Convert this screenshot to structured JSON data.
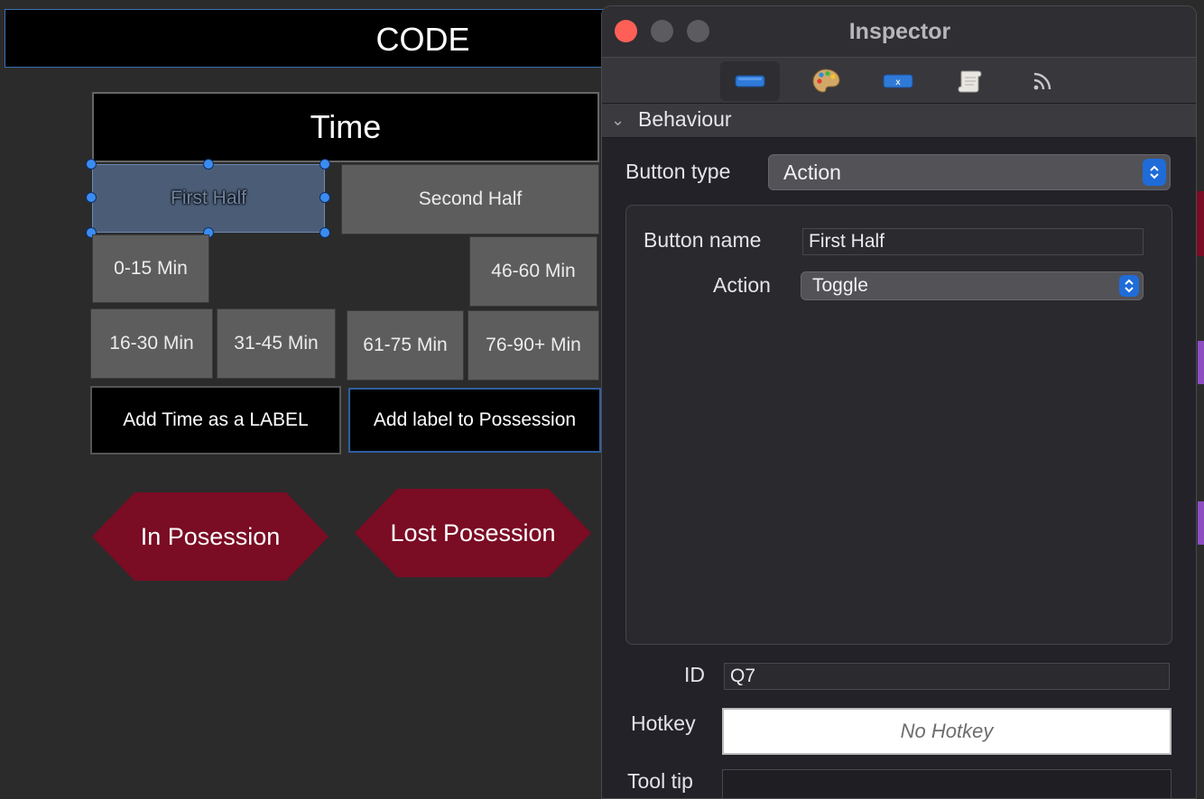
{
  "canvas": {
    "code_title": "CODE",
    "time_header": "Time",
    "first_half": "First Half",
    "second_half": "Second Half",
    "min_0_15": "0-15 Min",
    "min_46_60": "46-60 Min",
    "min_16_30": "16-30 Min",
    "min_31_45": "31-45 Min",
    "min_61_75": "61-75 Min",
    "min_76_90": "76-90+ Min",
    "add_time_label": "Add Time as a LABEL",
    "add_label_possession": "Add label to Possession",
    "in_possession": "In Posession",
    "lost_possession": "Lost Posession"
  },
  "inspector": {
    "title": "Inspector",
    "toolbar_icons": [
      "button-icon",
      "palette-icon",
      "text-field-icon",
      "script-icon",
      "feed-icon"
    ],
    "section": "Behaviour",
    "button_type_label": "Button type",
    "button_type_value": "Action",
    "button_name_label": "Button name",
    "button_name_value": "First Half",
    "action_label": "Action",
    "action_value": "Toggle",
    "id_label": "ID",
    "id_value": "Q7",
    "hotkey_label": "Hotkey",
    "hotkey_value": "No Hotkey",
    "tooltip_label": "Tool tip",
    "tooltip_value": ""
  },
  "colors": {
    "possession_red": "#7a0c24",
    "selection_blue": "#3c8cf0",
    "stepper_blue": "#1f6cd9",
    "close_red": "#fe5f57"
  }
}
